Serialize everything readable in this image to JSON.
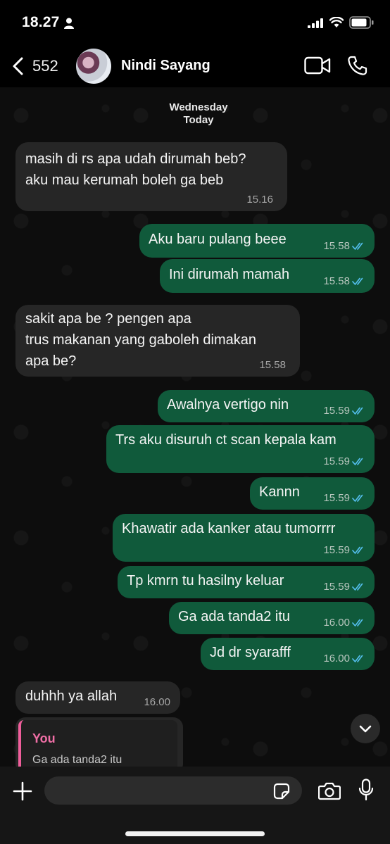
{
  "status_bar": {
    "time": "18.27"
  },
  "header": {
    "back_count": "552",
    "contact_name": "Nindi Sayang"
  },
  "date_chip": {
    "day": "Wednesday",
    "label": "Today"
  },
  "messages": [
    {
      "dir": "in",
      "text": "masih di rs apa udah dirumah beb?\naku mau kerumah boleh ga beb",
      "time": "15.16"
    },
    {
      "dir": "out",
      "text": "Aku baru pulang beee",
      "time": "15.58",
      "read": true
    },
    {
      "dir": "out",
      "text": "Ini dirumah mamah",
      "time": "15.58",
      "read": true
    },
    {
      "dir": "in",
      "text": "sakit apa be ? pengen apa\ntrus makanan yang gaboleh dimakan\napa be?",
      "time": "15.58"
    },
    {
      "dir": "out",
      "text": "Awalnya vertigo nin",
      "time": "15.59",
      "read": true
    },
    {
      "dir": "out",
      "text": "Trs aku disuruh ct scan kepala kam",
      "time": "15.59",
      "read": true
    },
    {
      "dir": "out",
      "text": "Kannn",
      "time": "15.59",
      "read": true
    },
    {
      "dir": "out",
      "text": "Khawatir ada kanker atau tumorrrr",
      "time": "15.59",
      "read": true
    },
    {
      "dir": "out",
      "text": "Tp kmrn tu hasilny keluar",
      "time": "15.59",
      "read": true
    },
    {
      "dir": "out",
      "text": "Ga ada tanda2 itu",
      "time": "16.00",
      "read": true
    },
    {
      "dir": "out",
      "text": "Jd dr syarafff",
      "time": "16.00",
      "read": true
    },
    {
      "dir": "in",
      "text": "duhhh ya allah",
      "time": "16.00"
    }
  ],
  "reply_preview": {
    "sender": "You",
    "text": "Ga ada tanda2 itu"
  },
  "composer": {
    "placeholder": ""
  },
  "colors": {
    "outgoing_bubble": "#105a3b",
    "incoming_bubble": "#262626",
    "read_ticks": "#53bdeb",
    "reply_accent": "#ef5e9b"
  },
  "icons": [
    "back-chevron-icon",
    "video-call-icon",
    "phone-icon",
    "plus-icon",
    "sticker-icon",
    "camera-icon",
    "microphone-icon",
    "chevron-down-icon"
  ]
}
